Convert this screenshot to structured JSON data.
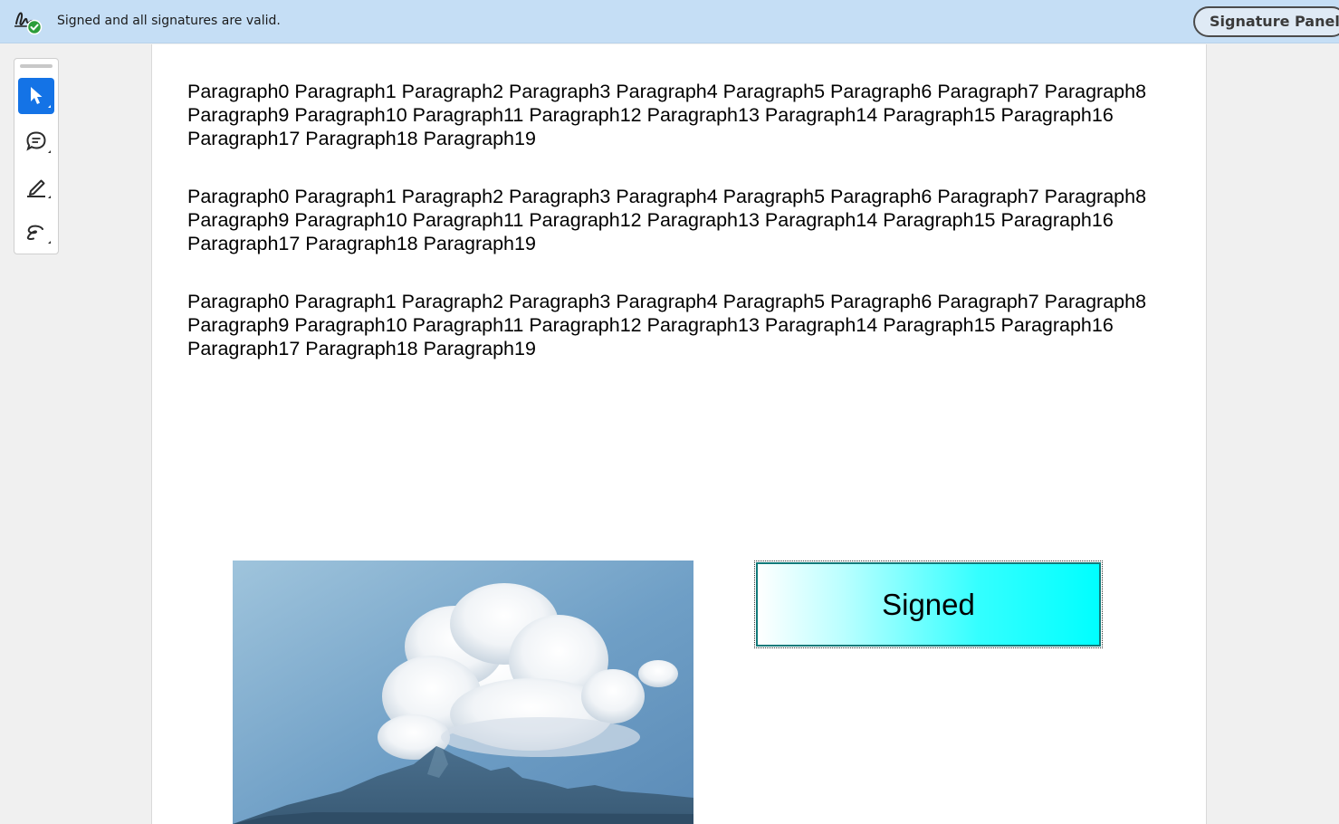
{
  "signature_bar": {
    "status_text": "Signed and all signatures are valid.",
    "status_icon": "signature-valid-icon",
    "panel_button_label": "Signature Panel"
  },
  "tools": [
    {
      "name": "select-tool",
      "icon": "pointer-icon",
      "active": true
    },
    {
      "name": "comment-tool",
      "icon": "comment-icon",
      "active": false
    },
    {
      "name": "highlight-tool",
      "icon": "pen-icon",
      "active": false
    },
    {
      "name": "draw-tool",
      "icon": "freehand-icon",
      "active": false
    }
  ],
  "document": {
    "paragraphs": [
      "Paragraph0 Paragraph1 Paragraph2 Paragraph3 Paragraph4 Paragraph5 Paragraph6 Paragraph7 Paragraph8 Paragraph9 Paragraph10 Paragraph11 Paragraph12 Paragraph13 Paragraph14 Paragraph15 Paragraph16 Paragraph17 Paragraph18 Paragraph19",
      "Paragraph0 Paragraph1 Paragraph2 Paragraph3 Paragraph4 Paragraph5 Paragraph6 Paragraph7 Paragraph8 Paragraph9 Paragraph10 Paragraph11 Paragraph12 Paragraph13 Paragraph14 Paragraph15 Paragraph16 Paragraph17 Paragraph18 Paragraph19",
      "Paragraph0 Paragraph1 Paragraph2 Paragraph3 Paragraph4 Paragraph5 Paragraph6 Paragraph7 Paragraph8 Paragraph9 Paragraph10 Paragraph11 Paragraph12 Paragraph13 Paragraph14 Paragraph15 Paragraph16 Paragraph17 Paragraph18 Paragraph19"
    ],
    "signature_field_label": "Signed"
  },
  "colors": {
    "sigbar_bg": "#c5def5",
    "accent": "#1473e6",
    "valid_green": "#2d9d3a",
    "field_cyan": "#00ffff"
  }
}
